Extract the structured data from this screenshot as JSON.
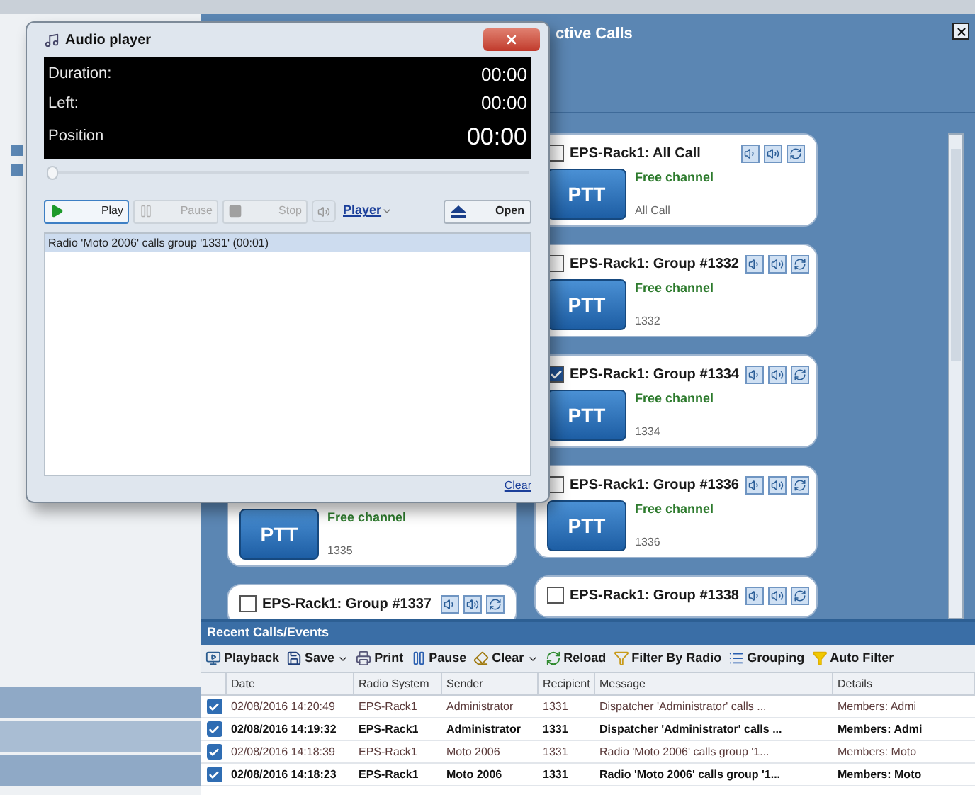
{
  "audio_player": {
    "title": "Audio player",
    "display": [
      {
        "label": "Duration:",
        "value": "00:00",
        "emphasis": false
      },
      {
        "label": "Left:",
        "value": "00:00",
        "emphasis": false
      },
      {
        "label": "Position",
        "value": "00:00",
        "emphasis": true
      }
    ],
    "position_slider": {
      "level": 0
    },
    "buttons": [
      {
        "label": "Play",
        "kind": "play",
        "disabled": false
      },
      {
        "label": "Pause",
        "kind": "pause",
        "disabled": true
      },
      {
        "label": "Stop",
        "kind": "stop",
        "disabled": true
      }
    ],
    "player_menu": "Player",
    "open_button": "Open",
    "playlist": [
      {
        "text": "Radio 'Moto 2006' calls group '1331' (00:01)",
        "selected": true
      }
    ],
    "clear_link": "Clear"
  },
  "active_calls": {
    "title": "ctive Calls",
    "left_column": [
      {
        "status": "Free channel",
        "group_id": "1335",
        "ptt": "PTT"
      },
      {
        "title": "EPS-Rack1: Group #1337",
        "checked": false
      }
    ],
    "right_column": [
      {
        "title": "EPS-Rack1: All Call",
        "checked": false,
        "status": "Free channel",
        "group_id": "All Call",
        "ptt": "PTT"
      },
      {
        "title": "EPS-Rack1: Group #1332",
        "checked": false,
        "status": "Free channel",
        "group_id": "1332",
        "ptt": "PTT"
      },
      {
        "title": "EPS-Rack1: Group #1334",
        "checked": true,
        "status": "Free channel",
        "group_id": "1334",
        "ptt": "PTT"
      },
      {
        "title": "EPS-Rack1: Group #1336",
        "checked": false,
        "status": "Free channel",
        "group_id": "1336",
        "ptt": "PTT"
      },
      {
        "title": "EPS-Rack1: Group #1338",
        "checked": false
      }
    ]
  },
  "recent_calls": {
    "title": "Recent Calls/Events",
    "toolbar": [
      {
        "label": "Playback",
        "kind": "playback",
        "menu": false
      },
      {
        "label": "Save",
        "kind": "save",
        "menu": true
      },
      {
        "label": "Print",
        "kind": "print",
        "menu": false
      },
      {
        "label": "Pause",
        "kind": "pause",
        "menu": false
      },
      {
        "label": "Clear",
        "kind": "clear",
        "menu": true
      },
      {
        "label": "Reload",
        "kind": "reload",
        "menu": false
      },
      {
        "label": "Filter By Radio",
        "kind": "filter_radio",
        "menu": false
      },
      {
        "label": "Grouping",
        "kind": "grouping",
        "menu": false
      },
      {
        "label": "Auto Filter",
        "kind": "auto_filter",
        "menu": false
      }
    ],
    "columns": [
      "Date",
      "Radio System",
      "Sender",
      "Recipient",
      "Message",
      "Details"
    ],
    "rows": [
      {
        "unread": false,
        "cells": [
          "02/08/2016 14:20:49",
          "EPS-Rack1",
          "Administrator",
          "1331",
          "Dispatcher 'Administrator' calls ...",
          "Members: Admi"
        ]
      },
      {
        "unread": true,
        "cells": [
          "02/08/2016 14:19:32",
          "EPS-Rack1",
          "Administrator",
          "1331",
          "Dispatcher 'Administrator' calls ...",
          "Members: Admi"
        ]
      },
      {
        "unread": false,
        "cells": [
          "02/08/2016 14:18:39",
          "EPS-Rack1",
          "Moto 2006",
          "1331",
          "Radio 'Moto 2006' calls group '1...",
          "Members: Moto"
        ]
      },
      {
        "unread": true,
        "cells": [
          "02/08/2016 14:18:23",
          "EPS-Rack1",
          "Moto 2006",
          "1331",
          "Radio 'Moto 2006' calls group '1...",
          "Members: Moto"
        ]
      }
    ]
  }
}
